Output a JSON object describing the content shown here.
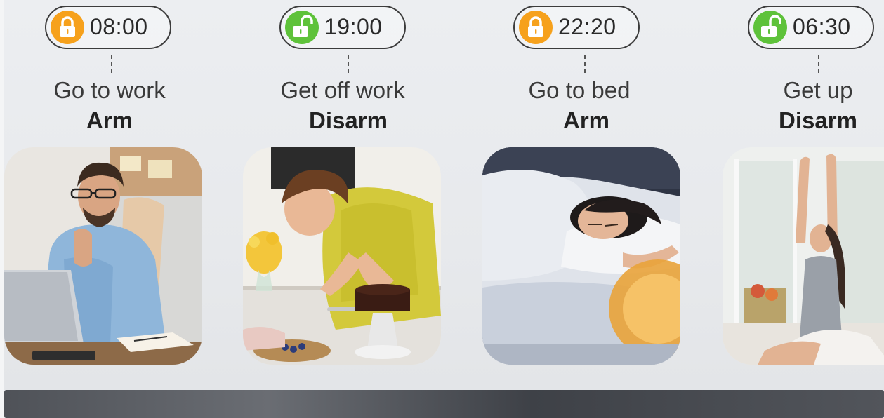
{
  "schedule": [
    {
      "time": "08:00",
      "activity": "Go to work",
      "mode": "Arm",
      "lock_state": "locked",
      "lock_color": "#f6a11c",
      "photo": "man working at laptop"
    },
    {
      "time": "19:00",
      "activity": "Get off work",
      "mode": "Disarm",
      "lock_state": "unlocked",
      "lock_color": "#5ec23a",
      "photo": "woman decorating a cake"
    },
    {
      "time": "22:20",
      "activity": "Go to bed",
      "mode": "Arm",
      "lock_state": "locked",
      "lock_color": "#f6a11c",
      "photo": "woman sleeping in bed"
    },
    {
      "time": "06:30",
      "activity": "Get up",
      "mode": "Disarm",
      "lock_state": "unlocked",
      "lock_color": "#5ec23a",
      "photo": "woman stretching in the morning"
    }
  ],
  "colors": {
    "armed": "#f6a11c",
    "disarmed": "#5ec23a",
    "pill_border": "#3c3c3c"
  }
}
